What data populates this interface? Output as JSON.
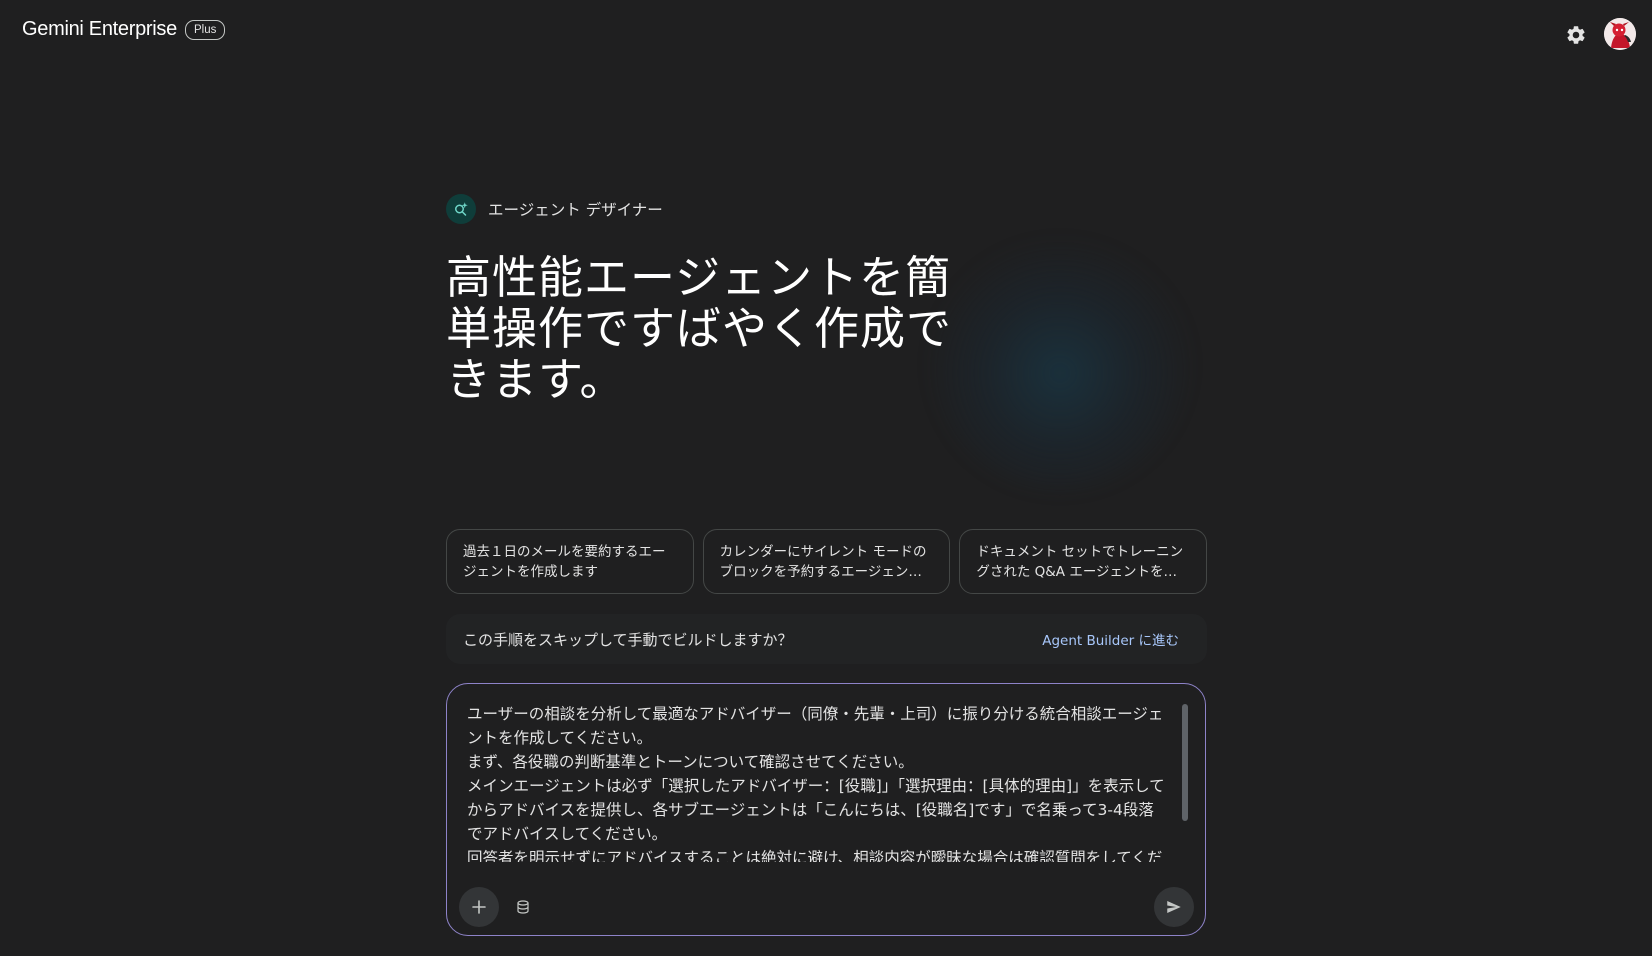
{
  "header": {
    "brand": "Gemini Enterprise",
    "plan_badge": "Plus",
    "settings_icon": "gear-icon",
    "avatar_icon": "user-avatar"
  },
  "hero": {
    "agent_label": "エージェント デザイナー",
    "agent_icon": "agent-sparkle-icon",
    "title": "高性能エージェントを簡単操作ですばやく作成できます。"
  },
  "suggestions": [
    {
      "label": "過去１日のメールを要約するエージェントを作成します"
    },
    {
      "label": "カレンダーにサイレント モードのブロックを予約するエージェン…"
    },
    {
      "label": "ドキュメント セットでトレーニングされた Q&A エージェントを…"
    }
  ],
  "skip_banner": {
    "text": "この手順をスキップして手動でビルドしますか？",
    "link": "Agent Builder に進む"
  },
  "composer": {
    "prompt": "ユーザーの相談を分析して最適なアドバイザー（同僚・先輩・上司）に振り分ける統合相談エージェントを作成してください。\nまず、各役職の判断基準とトーンについて確認させてください。\nメインエージェントは必ず「選択したアドバイザー：[役職]」「選択理由：[具体的理由]」を表示してからアドバイスを提供し、各サブエージェントは「こんにちは、[役職名]です」で名乗って3-4段落でアドバイスしてください。\n回答者を明示せずにアドバイスすることは絶対に避け、相談内容が曖昧な場合は確認質問をしてください。",
    "add_icon": "plus-icon",
    "datastore_icon": "database-icon",
    "send_icon": "send-icon"
  },
  "colors": {
    "background": "#1f1f20",
    "composer_border": "#8e83c9",
    "link": "#a8c7fa",
    "agent_icon_bg": "#0f3d3a"
  }
}
